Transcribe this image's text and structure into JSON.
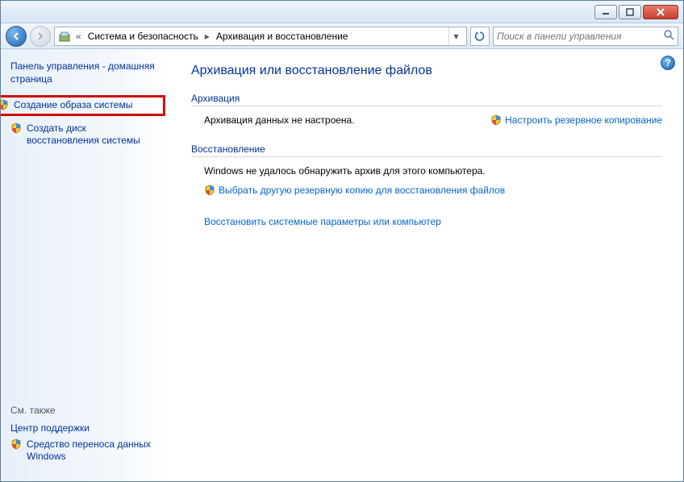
{
  "breadcrumb": {
    "parent": "Система и безопасность",
    "current": "Архивация и восстановление",
    "prefix": "«"
  },
  "search": {
    "placeholder": "Поиск в панели управления"
  },
  "sidebar": {
    "home": "Панель управления - домашняя страница",
    "tasks": [
      {
        "label": "Создание образа системы"
      },
      {
        "label": "Создать диск восстановления системы"
      }
    ],
    "see_also_title": "См. также",
    "see_also": [
      {
        "label": "Центр поддержки"
      },
      {
        "label": "Средство переноса данных Windows",
        "shield": true
      }
    ]
  },
  "main": {
    "title": "Архивация или восстановление файлов",
    "backup": {
      "heading": "Архивация",
      "status": "Архивация данных не настроена.",
      "action": "Настроить резервное копирование"
    },
    "restore": {
      "heading": "Восстановление",
      "status": "Windows не удалось обнаружить архив для этого компьютера.",
      "action": "Выбрать другую резервную копию для восстановления файлов",
      "sys_restore": "Восстановить системные параметры или компьютер"
    }
  }
}
